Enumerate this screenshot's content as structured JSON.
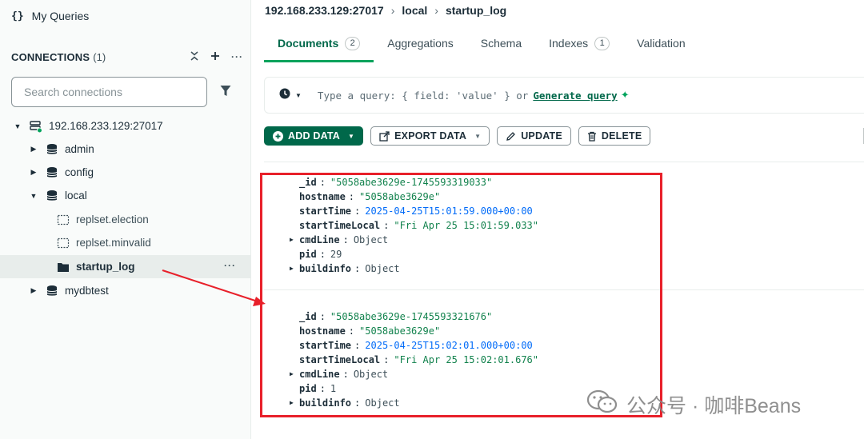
{
  "sidebar": {
    "my_queries": "My Queries",
    "connections_title": "CONNECTIONS",
    "connections_count": "(1)",
    "search_placeholder": "Search connections",
    "host": "192.168.233.129:27017",
    "databases": [
      {
        "name": "admin"
      },
      {
        "name": "config"
      },
      {
        "name": "local",
        "collections": [
          "replset.election",
          "replset.minvalid",
          "startup_log"
        ]
      },
      {
        "name": "mydbtest"
      }
    ]
  },
  "breadcrumb": [
    "192.168.233.129:27017",
    "local",
    "startup_log"
  ],
  "tabs": [
    {
      "label": "Documents",
      "badge": "2"
    },
    {
      "label": "Aggregations"
    },
    {
      "label": "Schema"
    },
    {
      "label": "Indexes",
      "badge": "1"
    },
    {
      "label": "Validation"
    }
  ],
  "query": {
    "placeholder": "Type a query: { field: 'value' } or",
    "generate": "Generate query"
  },
  "toolbar": {
    "add_data": "ADD DATA",
    "export_data": "EXPORT DATA",
    "update": "UPDATE",
    "delete": "DELETE"
  },
  "documents": [
    {
      "_id": "\"5058abe3629e-1745593319033\"",
      "hostname": "\"5058abe3629e\"",
      "startTime": "2025-04-25T15:01:59.000+00:00",
      "startTimeLocal": "\"Fri Apr 25 15:01:59.033\"",
      "cmdLine": "Object",
      "pid": "29",
      "buildinfo": "Object"
    },
    {
      "_id": "\"5058abe3629e-1745593321676\"",
      "hostname": "\"5058abe3629e\"",
      "startTime": "2025-04-25T15:02:01.000+00:00",
      "startTimeLocal": "\"Fri Apr 25 15:02:01.676\"",
      "cmdLine": "Object",
      "pid": "1",
      "buildinfo": "Object"
    }
  ],
  "field_names": {
    "id": "_id",
    "hostname": "hostname",
    "startTime": "startTime",
    "startTimeLocal": "startTimeLocal",
    "cmdLine": "cmdLine",
    "pid": "pid",
    "buildinfo": "buildinfo"
  },
  "watermark": "公众号 · 咖啡Beans",
  "colors": {
    "accent_green": "#00684a",
    "highlight_red": "#e8202a",
    "string_green": "#12824d",
    "date_blue": "#016bf8"
  }
}
